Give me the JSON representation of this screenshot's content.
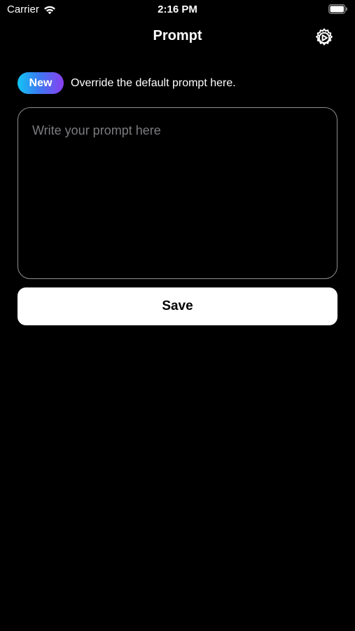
{
  "status_bar": {
    "carrier": "Carrier",
    "time": "2:16 PM",
    "wifi_icon": "wifi-icon",
    "battery_icon": "battery-icon"
  },
  "nav": {
    "title": "Prompt",
    "settings_icon": "gear-play-icon"
  },
  "notice": {
    "badge": "New",
    "text": "Override the default prompt here.",
    "badge_gradient": [
      "#12c6f3",
      "#3a7bf2",
      "#8a3ff0"
    ]
  },
  "prompt": {
    "value": "",
    "placeholder": "Write your prompt here"
  },
  "actions": {
    "save_label": "Save"
  },
  "colors": {
    "background": "#000000",
    "text": "#ffffff",
    "input_border": "#8e8e93",
    "placeholder": "#7c7c80",
    "button_bg": "#ffffff",
    "button_text": "#000000"
  }
}
